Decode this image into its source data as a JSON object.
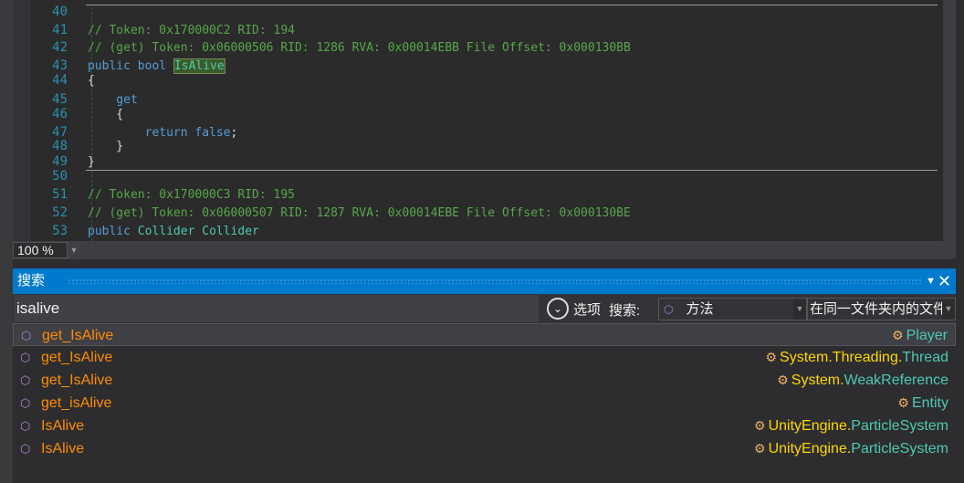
{
  "editor": {
    "lines": [
      {
        "n": "40",
        "parts": []
      },
      {
        "n": "41",
        "parts": [
          {
            "c": "cm",
            "t": "// Token: 0x170000C2 RID: 194"
          }
        ]
      },
      {
        "n": "42",
        "parts": [
          {
            "c": "cm",
            "t": "// (get) Token: 0x06000506 RID: 1286 RVA: 0x00014EBB File Offset: 0x000130BB"
          }
        ]
      },
      {
        "n": "43",
        "parts": [
          {
            "c": "kw",
            "t": "public bool "
          },
          {
            "c": "hl",
            "t": "IsAlive"
          }
        ]
      },
      {
        "n": "44",
        "parts": [
          {
            "c": "",
            "t": "{"
          }
        ]
      },
      {
        "n": "45",
        "parts": [
          {
            "c": "kw",
            "t": "    get"
          }
        ]
      },
      {
        "n": "46",
        "parts": [
          {
            "c": "",
            "t": "    {"
          }
        ]
      },
      {
        "n": "47",
        "parts": [
          {
            "c": "kw",
            "t": "        return false"
          },
          {
            "c": "",
            "t": ";"
          }
        ]
      },
      {
        "n": "48",
        "parts": [
          {
            "c": "",
            "t": "    }"
          }
        ]
      },
      {
        "n": "49",
        "parts": [
          {
            "c": "",
            "t": "}"
          }
        ]
      },
      {
        "n": "50",
        "parts": []
      },
      {
        "n": "51",
        "parts": [
          {
            "c": "cm",
            "t": "// Token: 0x170000C3 RID: 195"
          }
        ]
      },
      {
        "n": "52",
        "parts": [
          {
            "c": "cm",
            "t": "// (get) Token: 0x06000507 RID: 1287 RVA: 0x00014EBE File Offset: 0x000130BE"
          }
        ]
      },
      {
        "n": "53",
        "parts": [
          {
            "c": "kw",
            "t": "public "
          },
          {
            "c": "ty",
            "t": "Collider Collider"
          }
        ]
      }
    ]
  },
  "zoom": "100 %",
  "search": {
    "title": "搜索",
    "query": "isalive",
    "options_label": "选项",
    "search_label": "搜索:",
    "kind": "方法",
    "scope": "在同一文件夹内的文件",
    "results": [
      {
        "name": "get_IsAlive",
        "ns": "",
        "type": "Player",
        "selected": true
      },
      {
        "name": "get_IsAlive",
        "ns": "System.Threading.",
        "type": "Thread"
      },
      {
        "name": "get_IsAlive",
        "ns": "System.",
        "type": "WeakReference"
      },
      {
        "name": "get_isAlive",
        "ns": "",
        "type": "Entity"
      },
      {
        "name": "IsAlive",
        "ns": "UnityEngine.",
        "type": "ParticleSystem"
      },
      {
        "name": "IsAlive",
        "ns": "UnityEngine.",
        "type": "ParticleSystem"
      }
    ]
  }
}
